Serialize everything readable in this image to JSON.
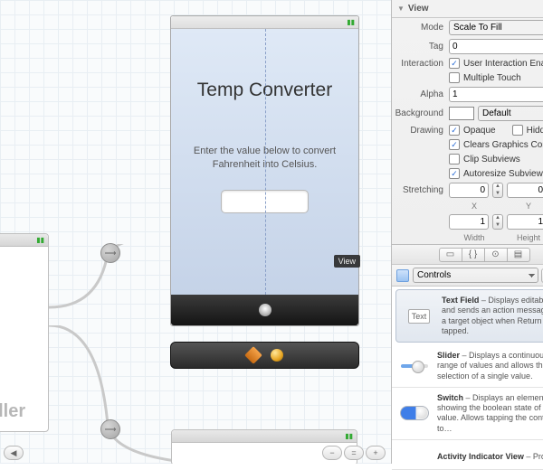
{
  "canvas": {
    "left_vc_label": "oller",
    "iphone": {
      "title": "Temp Converter",
      "subtitle_line1": "Enter the value below to convert",
      "subtitle_line2": "Fahrenheit into Celsius.",
      "badge": "View"
    },
    "zoom": {
      "out": "−",
      "fit": "=",
      "in": "+"
    },
    "back": "◀"
  },
  "inspector": {
    "section": "View",
    "rows": {
      "mode_label": "Mode",
      "mode_value": "Scale To Fill",
      "tag_label": "Tag",
      "tag_value": "0",
      "interaction_label": "Interaction",
      "interaction_user": "User Interaction Enabled",
      "interaction_multi": "Multiple Touch",
      "alpha_label": "Alpha",
      "alpha_value": "1",
      "background_label": "Background",
      "background_value": "Default",
      "drawing_label": "Drawing",
      "drawing_opaque": "Opaque",
      "drawing_hidden": "Hidden",
      "drawing_clears": "Clears Graphics Context",
      "drawing_clip": "Clip Subviews",
      "drawing_auto": "Autoresize Subviews",
      "stretching_label": "Stretching",
      "stretching_x": "0",
      "stretching_y": "0",
      "stretching_x_lab": "X",
      "stretching_y_lab": "Y",
      "stretching_w": "1",
      "stretching_h": "1",
      "stretching_w_lab": "Width",
      "stretching_h_lab": "Height"
    }
  },
  "library": {
    "category": "Controls",
    "items": [
      {
        "name": "Text Field",
        "desc": "Displays editable text and sends an action message to a target object when Return is tapped."
      },
      {
        "name": "Slider",
        "desc": "Displays a continuous range of values and allows the selection of a single value."
      },
      {
        "name": "Switch",
        "desc": "Displays an element showing the boolean state of a value. Allows tapping the control to…"
      },
      {
        "name": "Activity Indicator View",
        "desc": "Provides"
      }
    ]
  }
}
